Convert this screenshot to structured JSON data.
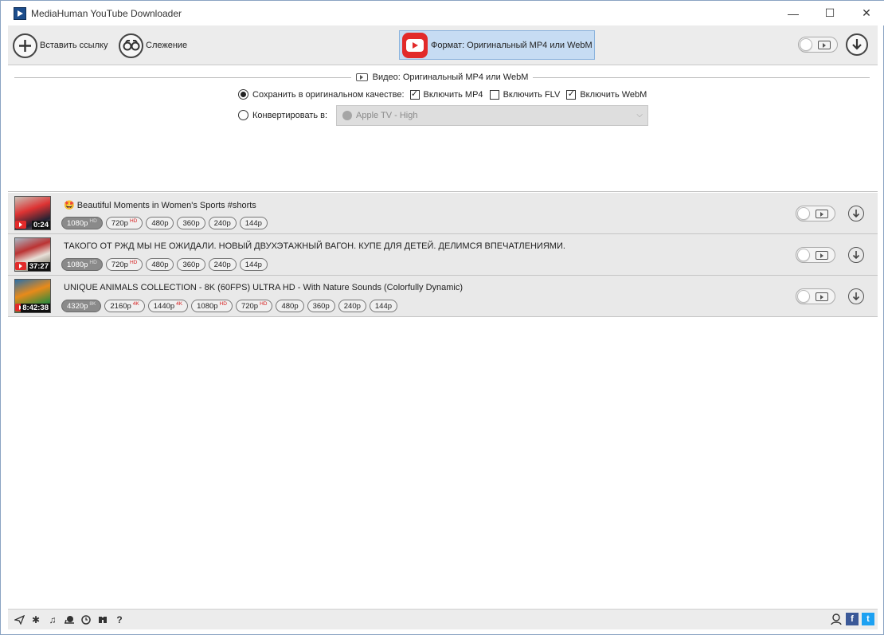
{
  "window": {
    "title": "MediaHuman YouTube Downloader"
  },
  "toolbar": {
    "paste_label": "Вставить ссылку",
    "tracking_label": "Слежение",
    "format_label": "Формат: Оригинальный MP4 или WebM"
  },
  "panel": {
    "title": "Видео: Оригинальный MP4 или WebM",
    "save_original_label": "Сохранить в оригинальном качестве:",
    "include_mp4_label": "Включить MP4",
    "include_flv_label": "Включить FLV",
    "include_webm_label": "Включить WebM",
    "convert_label": "Конвертировать в:",
    "convert_select_value": "Apple TV - High",
    "save_original_selected": true,
    "include_mp4_checked": true,
    "include_flv_checked": false,
    "include_webm_checked": true
  },
  "videos": [
    {
      "title": "🤩 Beautiful Moments in Women's Sports #shorts",
      "duration": "0:24",
      "qualities": [
        {
          "label": "1080p",
          "badge": "HD",
          "selected": true
        },
        {
          "label": "720p",
          "badge": "HD",
          "selected": false
        },
        {
          "label": "480p",
          "badge": "",
          "selected": false
        },
        {
          "label": "360p",
          "badge": "",
          "selected": false
        },
        {
          "label": "240p",
          "badge": "",
          "selected": false
        },
        {
          "label": "144p",
          "badge": "",
          "selected": false
        }
      ]
    },
    {
      "title": "ТАКОГО ОТ РЖД МЫ НЕ ОЖИДАЛИ. НОВЫЙ ДВУХЭТАЖНЫЙ ВАГОН. КУПЕ ДЛЯ ДЕТЕЙ. ДЕЛИМСЯ ВПЕЧАТЛЕНИЯМИ.",
      "duration": "37:27",
      "qualities": [
        {
          "label": "1080p",
          "badge": "HD",
          "selected": true
        },
        {
          "label": "720p",
          "badge": "HD",
          "selected": false
        },
        {
          "label": "480p",
          "badge": "",
          "selected": false
        },
        {
          "label": "360p",
          "badge": "",
          "selected": false
        },
        {
          "label": "240p",
          "badge": "",
          "selected": false
        },
        {
          "label": "144p",
          "badge": "",
          "selected": false
        }
      ]
    },
    {
      "title": "UNIQUE ANIMALS COLLECTION - 8K (60FPS) ULTRA HD - With Nature Sounds (Colorfully Dynamic)",
      "duration": "8:42:38",
      "qualities": [
        {
          "label": "4320p",
          "badge": "8K",
          "selected": true
        },
        {
          "label": "2160p",
          "badge": "4K",
          "selected": false
        },
        {
          "label": "1440p",
          "badge": "4K",
          "selected": false
        },
        {
          "label": "1080p",
          "badge": "HD",
          "selected": false
        },
        {
          "label": "720p",
          "badge": "HD",
          "selected": false
        },
        {
          "label": "480p",
          "badge": "",
          "selected": false
        },
        {
          "label": "360p",
          "badge": "",
          "selected": false
        },
        {
          "label": "240p",
          "badge": "",
          "selected": false
        },
        {
          "label": "144p",
          "badge": "",
          "selected": false
        }
      ]
    }
  ],
  "statusbar": {
    "icons": [
      "send-icon",
      "gear-icon",
      "music-icon",
      "snail-icon",
      "clock-icon",
      "binoculars-icon",
      "help-icon"
    ],
    "help_glyph": "?",
    "facebook_glyph": "f",
    "twitter_glyph": "t"
  },
  "colors": {
    "accent": "#c6dcf3",
    "youtube_red": "#e22a2a",
    "badge_red": "#d62020"
  }
}
